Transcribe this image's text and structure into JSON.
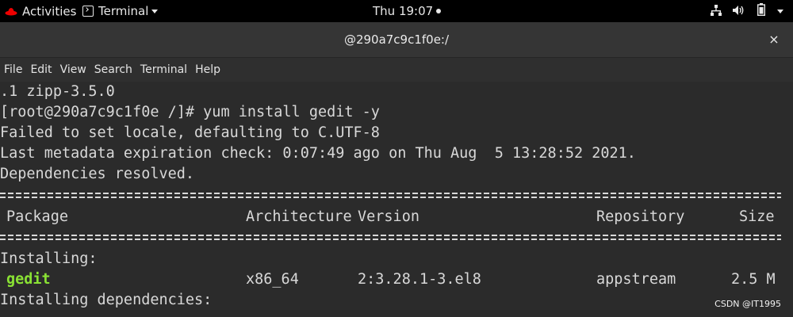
{
  "topbar": {
    "activities": "Activities",
    "app_menu": "Terminal",
    "clock": "Thu 19:07",
    "tray_icons": [
      "network-icon",
      "volume-icon",
      "battery-icon",
      "power-menu-icon"
    ]
  },
  "window": {
    "title": "@290a7c9c1f0e:/",
    "close": "×"
  },
  "menu": [
    "File",
    "Edit",
    "View",
    "Search",
    "Terminal",
    "Help"
  ],
  "terminal": {
    "lines": [
      ".1 zipp-3.5.0",
      "[root@290a7c9c1f0e /]# yum install gedit -y",
      "Failed to set locale, defaulting to C.UTF-8",
      "Last metadata expiration check: 0:07:49 ago on Thu Aug  5 13:28:52 2021.",
      "Dependencies resolved."
    ],
    "table_headers": {
      "package": "Package",
      "architecture": "Architecture",
      "version": "Version",
      "repository": "Repository",
      "size": "Size"
    },
    "section_installing": "Installing:",
    "row_gedit": {
      "package": "gedit",
      "architecture": "x86_64",
      "version": "2:3.28.1-3.el8",
      "repository": "appstream",
      "size": "2.5 M"
    },
    "section_dependencies": "Installing dependencies:"
  },
  "watermark": "CSDN @IT1995",
  "colors": {
    "terminal_bg": "#2b2b2b",
    "terminal_fg": "#d8d8d8",
    "highlight_package": "#8ae234",
    "topbar_bg": "#000000"
  }
}
